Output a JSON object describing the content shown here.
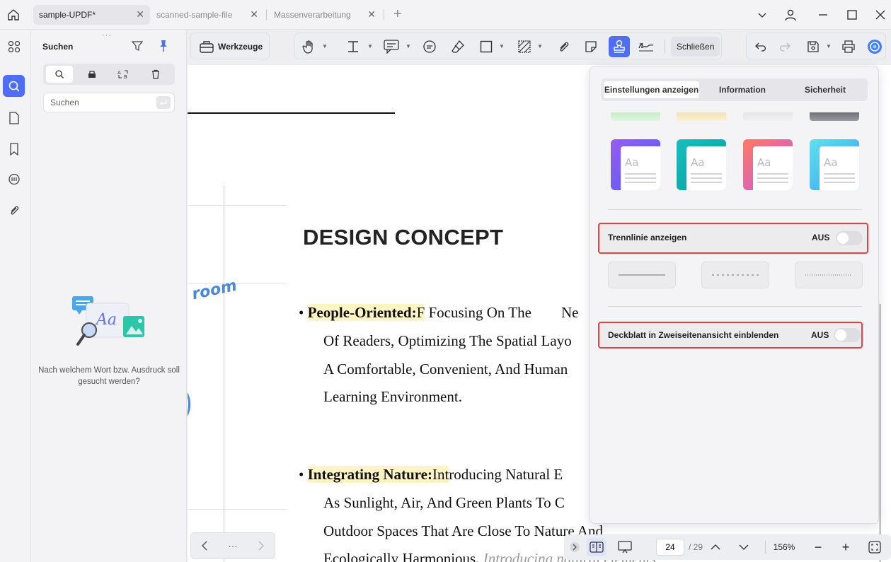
{
  "tabs": [
    {
      "label": "sample-UPDF*"
    },
    {
      "label": "scanned-sample-file"
    },
    {
      "label": "Massenverarbeitung"
    }
  ],
  "sidebar": {
    "title": "Suchen",
    "search_placeholder": "Suchen",
    "hint": "Nach welchem Wort bzw. Ausdruck soll gesucht werden?"
  },
  "toolbar": {
    "tools_label": "Werkzeuge",
    "close_label": "Schließen"
  },
  "document": {
    "heading": "DESIGN CONCEPT",
    "decor_word": "room",
    "bullet1_bold": "People-Oriented:",
    "bullet1_rest": " Focusing On The        Ne",
    "bullet1_hl_tail": "F",
    "bullet1_lines": [
      "Of Readers, Optimizing The Spatial Layo",
      "A Comfortable, Convenient, And Human",
      "Learning Environment."
    ],
    "bullet2_bold": "Integrating Nature:",
    "bullet2_hl_tail": "Int",
    "bullet2_rest": "roducing Natural E",
    "bullet2_lines": [
      "As Sunlight, Air, And Green Plants To C",
      "Outdoor Spaces That Are Close To Nature And",
      "Ecologically Harmonious."
    ],
    "bullet2_italic_tail": " Introducing natural elements"
  },
  "popover": {
    "tabs": [
      "Einstellungen anzeigen",
      "Information",
      "Sicherheit"
    ],
    "divider_label": "Trennlinie anzeigen",
    "divider_status": "AUS",
    "cover_label": "Deckblatt in Zweiseitenansicht einblenden",
    "cover_status": "AUS",
    "theme_sample": "Aa"
  },
  "pagination": {
    "current": "24",
    "total": "/ 29",
    "zoom": "156%",
    "more": "···"
  },
  "colors": {
    "accent": "#4f6ef7",
    "highlight": "#fff4c4",
    "outline_red": "#e04545"
  }
}
